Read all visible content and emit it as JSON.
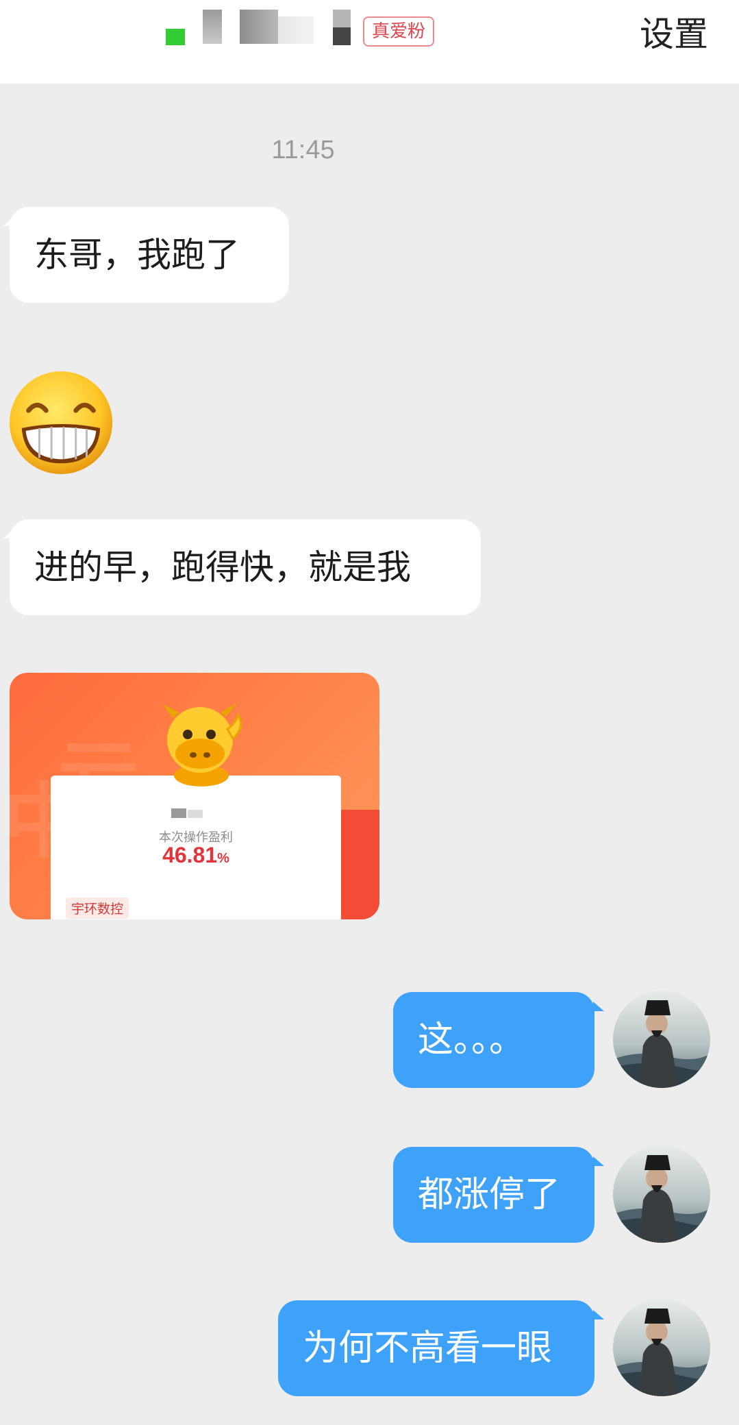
{
  "header": {
    "badge": "真爱粉",
    "settings_label": "设置"
  },
  "chat": {
    "timestamp": "11:45",
    "incoming": [
      {
        "text": "东哥，我跑了"
      },
      {
        "text": "进的早，跑得快，就是我"
      }
    ],
    "shared_image": {
      "label": "本次操作盈利",
      "profit_value": "46.81",
      "profit_unit": "%",
      "stock_tag": "宇环数控"
    },
    "outgoing": [
      {
        "text": "这。。。"
      },
      {
        "text": "都涨停了"
      },
      {
        "text": "为何不高看一眼"
      }
    ]
  },
  "colors": {
    "outgoing_bubble": "#3ea2fb",
    "incoming_bubble": "#ffffff",
    "chat_background": "#ededed",
    "badge": "#e0454f",
    "profit": "#e3343a"
  },
  "icons": {
    "emoji": "grinning-face-emoji",
    "avatar": "user-avatar",
    "mascot": "cow-mascot"
  }
}
